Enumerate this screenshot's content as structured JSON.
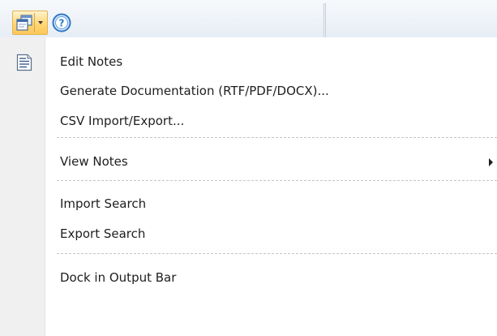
{
  "toolbar": {
    "main_button_icon": "windows-icon",
    "dropdown_icon": "chevron-down-icon",
    "help_icon": "help-icon"
  },
  "menu": {
    "items": [
      {
        "label": "Edit Notes",
        "icon": "notes-icon"
      },
      {
        "label": "Generate Documentation (RTF/PDF/DOCX)..."
      },
      {
        "label": "CSV Import/Export..."
      },
      {
        "label": "View Notes",
        "submenu": true
      },
      {
        "label": "Import Search"
      },
      {
        "label": "Export Search"
      },
      {
        "label": "Dock in Output Bar"
      }
    ]
  },
  "colors": {
    "button_highlight": "#ffd776",
    "help_blue": "#2f78c9",
    "gutter": "#f0f0f0"
  }
}
